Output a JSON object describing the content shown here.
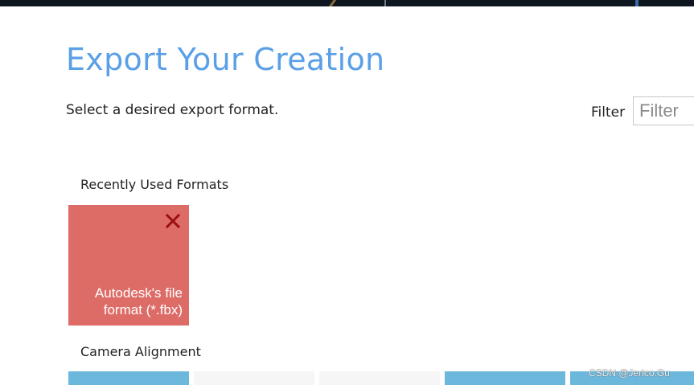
{
  "header": {
    "title": "Export Your Creation",
    "instruction": "Select a desired export format."
  },
  "filter": {
    "label": "Filter",
    "placeholder": "Filter",
    "value": ""
  },
  "sections": {
    "recent": {
      "heading": "Recently Used Formats",
      "tiles": [
        {
          "label_line1": "Autodesk's file",
          "label_line2": "format (*.fbx)",
          "color": "#dd6c67",
          "close_icon": "close-icon"
        }
      ]
    },
    "camera": {
      "heading": "Camera Alignment"
    }
  },
  "watermark": "CSDN @Jerico.Gu",
  "colors": {
    "title": "#5aa0e6",
    "tile_red": "#dd6c67",
    "tile_blue": "#6cb8dc",
    "close_x": "#9b0f0f"
  }
}
